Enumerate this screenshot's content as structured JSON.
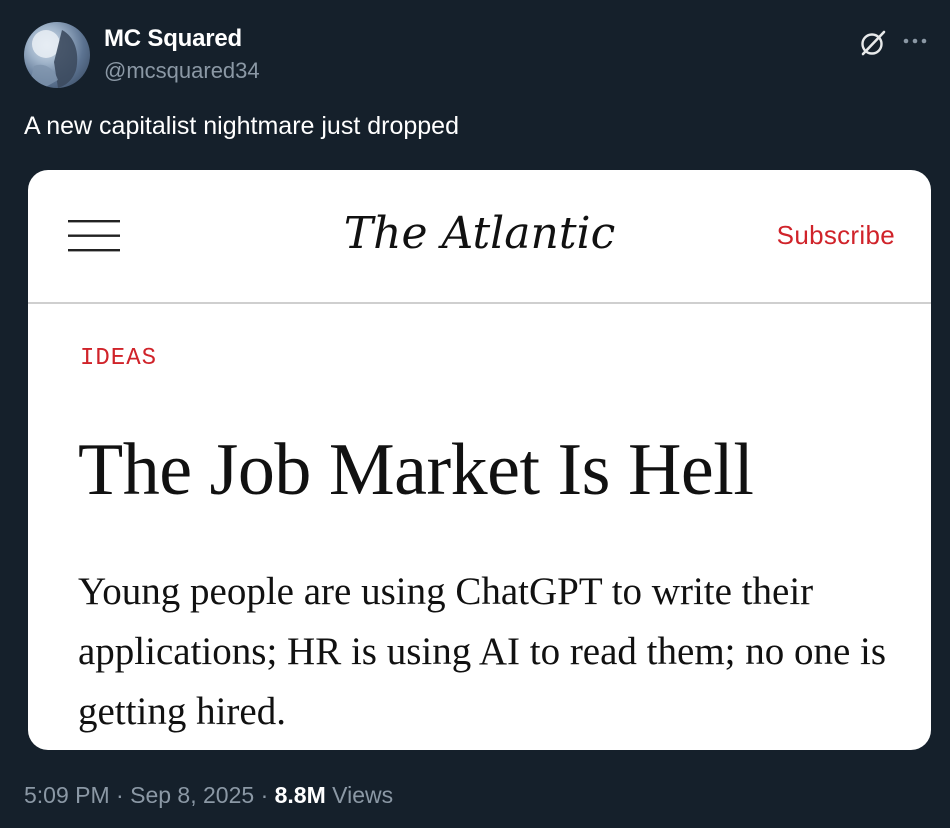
{
  "author": {
    "display_name": "MC Squared",
    "handle": "@mcsquared34",
    "avatar_icon": "avatar-photo"
  },
  "header_icons": {
    "grok": "grok-icon",
    "more": "more-options-icon"
  },
  "tweet": {
    "text": "A new capitalist nightmare just dropped"
  },
  "card": {
    "masthead": "The Atlantic",
    "subscribe_label": "Subscribe",
    "menu_icon": "hamburger-menu-icon",
    "section": "IDEAS",
    "headline": "The Job Market Is Hell",
    "dek": "Young people are using ChatGPT to write their applications; HR is using AI to read them; no one is getting hired."
  },
  "meta": {
    "time": "5:09 PM",
    "separator": "·",
    "date": "Sep 8, 2025",
    "views_count": "8.8M",
    "views_label": "Views"
  },
  "colors": {
    "background": "#15202b",
    "secondary_text": "#8b98a5",
    "atlantic_red": "#d0232a",
    "card_background": "#ffffff"
  }
}
